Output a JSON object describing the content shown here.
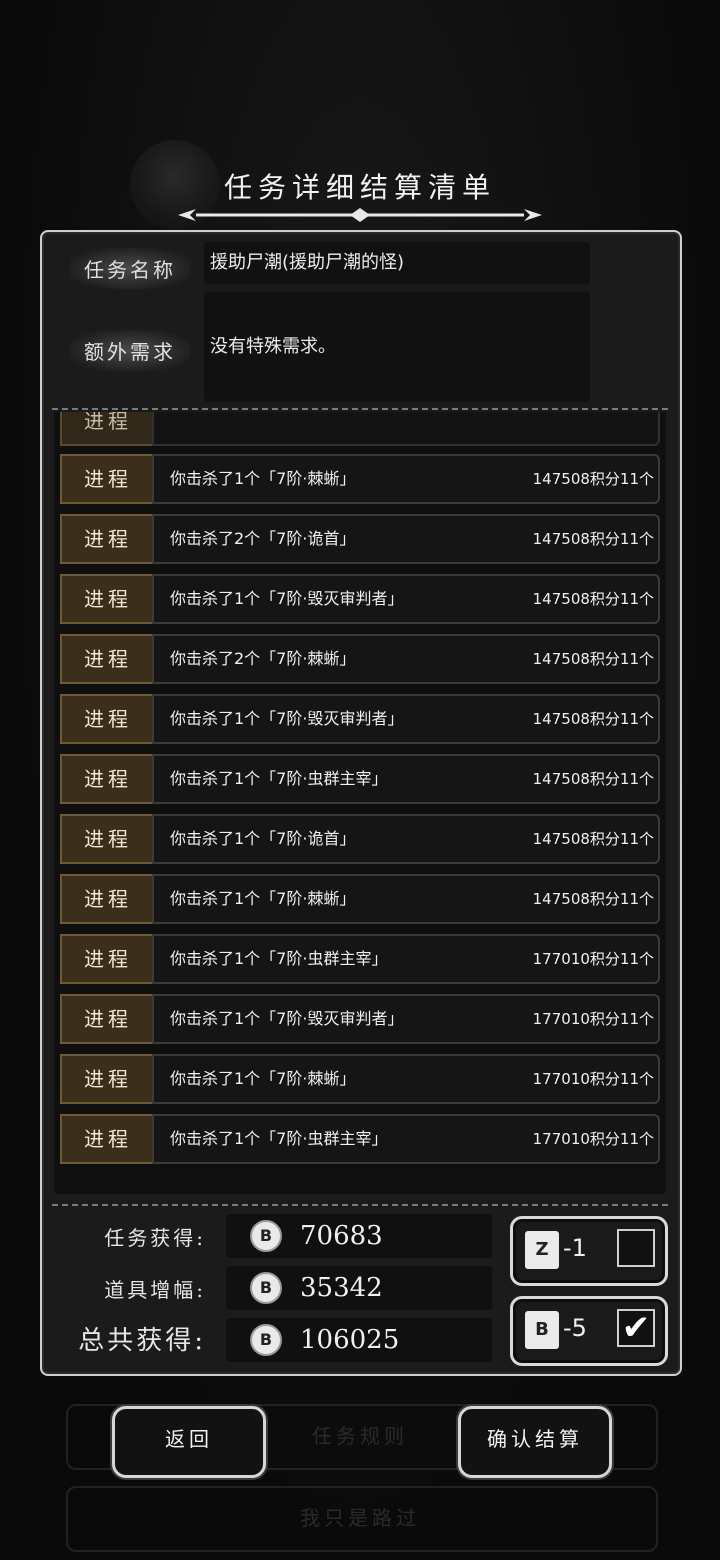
{
  "dialog": {
    "title": "任务详细结算清单"
  },
  "task": {
    "name_label": "任务名称",
    "name_value": "援助尸潮(援助尸潮的怪)",
    "extra_label": "额外需求",
    "extra_value": "没有特殊需求。"
  },
  "progress_rows": [
    {
      "tag": "进程",
      "desc": "你击杀了1个「7阶·棘蜥」",
      "points": "147508积分11个"
    },
    {
      "tag": "进程",
      "desc": "你击杀了2个「7阶·诡首」",
      "points": "147508积分11个"
    },
    {
      "tag": "进程",
      "desc": "你击杀了1个「7阶·毁灭审判者」",
      "points": "147508积分11个"
    },
    {
      "tag": "进程",
      "desc": "你击杀了2个「7阶·棘蜥」",
      "points": "147508积分11个"
    },
    {
      "tag": "进程",
      "desc": "你击杀了1个「7阶·毁灭审判者」",
      "points": "147508积分11个"
    },
    {
      "tag": "进程",
      "desc": "你击杀了1个「7阶·虫群主宰」",
      "points": "147508积分11个"
    },
    {
      "tag": "进程",
      "desc": "你击杀了1个「7阶·诡首」",
      "points": "147508积分11个"
    },
    {
      "tag": "进程",
      "desc": "你击杀了1个「7阶·棘蜥」",
      "points": "147508积分11个"
    },
    {
      "tag": "进程",
      "desc": "你击杀了1个「7阶·虫群主宰」",
      "points": "177010积分11个"
    },
    {
      "tag": "进程",
      "desc": "你击杀了1个「7阶·毁灭审判者」",
      "points": "177010积分11个"
    },
    {
      "tag": "进程",
      "desc": "你击杀了1个「7阶·棘蜥」",
      "points": "177010积分11个"
    },
    {
      "tag": "进程",
      "desc": "你击杀了1个「7阶·虫群主宰」",
      "points": "177010积分11个"
    }
  ],
  "rewards": {
    "task_label": "任务获得:",
    "task_value": "70683",
    "boost_label": "道具增幅:",
    "boost_value": "35342",
    "total_label": "总共获得:",
    "total_value": "106025",
    "coin_glyph": "B"
  },
  "options": {
    "item1_amount": "-1",
    "item1_checked": false,
    "item2_amount": "-5",
    "item2_checked": true
  },
  "buttons": {
    "back": "返回",
    "rules": "任务规则",
    "confirm": "确认结算",
    "pass": "我只是路过"
  }
}
